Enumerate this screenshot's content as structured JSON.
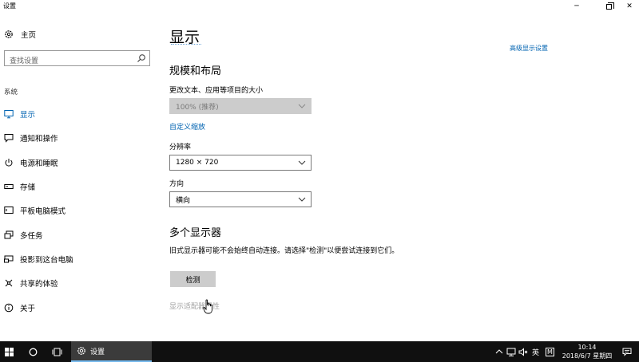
{
  "window": {
    "title": "设置",
    "controls": {
      "minimize": "─",
      "close": "✕"
    }
  },
  "sidebar": {
    "home_label": "主页",
    "search_placeholder": "查找设置",
    "section_label": "系统",
    "items": [
      {
        "label": "显示",
        "icon": "monitor-icon",
        "active": true
      },
      {
        "label": "通知和操作",
        "icon": "notification-icon",
        "active": false
      },
      {
        "label": "电源和睡眠",
        "icon": "power-icon",
        "active": false
      },
      {
        "label": "存储",
        "icon": "storage-icon",
        "active": false
      },
      {
        "label": "平板电脑模式",
        "icon": "tablet-icon",
        "active": false
      },
      {
        "label": "多任务",
        "icon": "multitask-icon",
        "active": false
      },
      {
        "label": "投影到这台电脑",
        "icon": "project-icon",
        "active": false
      },
      {
        "label": "共享的体验",
        "icon": "shared-icon",
        "active": false
      },
      {
        "label": "关于",
        "icon": "info-icon",
        "active": false
      }
    ]
  },
  "main": {
    "title": "显示",
    "related_link": "高级显示设置",
    "scale_section": {
      "heading": "规模和布局",
      "scale_label": "更改文本、应用等项目的大小",
      "scale_value": "100% (推荐)",
      "custom_scale_link": "自定义缩放",
      "resolution_label": "分辨率",
      "resolution_value": "1280 × 720",
      "orientation_label": "方向",
      "orientation_value": "横向"
    },
    "multi_display": {
      "heading": "多个显示器",
      "description": "旧式显示器可能不会始终自动连接。请选择\"检测\"以便尝试连接到它们。",
      "detect_button": "检测",
      "adapter_link": "显示适配器属性"
    }
  },
  "taskbar": {
    "app_label": "设置",
    "ime_label": "英",
    "ime_mode": "M",
    "time": "10:14",
    "date": "2018/6/7 星期四"
  },
  "colors": {
    "accent": "#0063b1",
    "taskbar": "#101010",
    "disabled_bg": "#cccccc"
  }
}
